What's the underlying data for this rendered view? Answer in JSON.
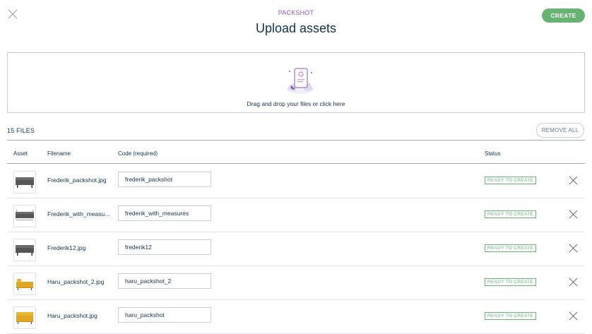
{
  "header": {
    "entity_label": "PACKSHOT",
    "title": "Upload assets",
    "create_label": "CREATE",
    "close_icon": "close-icon"
  },
  "dropzone": {
    "text": "Drag and drop your files or click here",
    "illustration": "upload-illustration"
  },
  "files": {
    "count_label": "15 FILES",
    "remove_all_label": "REMOVE ALL"
  },
  "table": {
    "columns": {
      "asset": "Asset",
      "filename": "Filename",
      "code": "Code (required)",
      "status": "Status"
    },
    "rows": [
      {
        "thumb": "grey-sofa",
        "filename": "Frederik_packshot.jpg",
        "code": "frederik_packshot",
        "status": "READY TO CREATE"
      },
      {
        "thumb": "grey-sofa-measures",
        "filename": "Frederik_with_measu...",
        "code": "frederik_with_measures",
        "status": "READY TO CREATE"
      },
      {
        "thumb": "grey-sofa",
        "filename": "Frederik12.jpg",
        "code": "frederik12",
        "status": "READY TO CREATE"
      },
      {
        "thumb": "yellow-sofa",
        "filename": "Haru_packshot_2.jpg",
        "code": "haru_packshot_2",
        "status": "READY TO CREATE"
      },
      {
        "thumb": "yellow-sofa",
        "filename": "Haru_packshot.jpg",
        "code": "haru_packshot",
        "status": "READY TO CREATE"
      }
    ]
  },
  "colors": {
    "accent_purple": "#9452ba",
    "success_green": "#67b373",
    "text_dark": "#11324d",
    "border_grey": "#c7cbd4"
  }
}
